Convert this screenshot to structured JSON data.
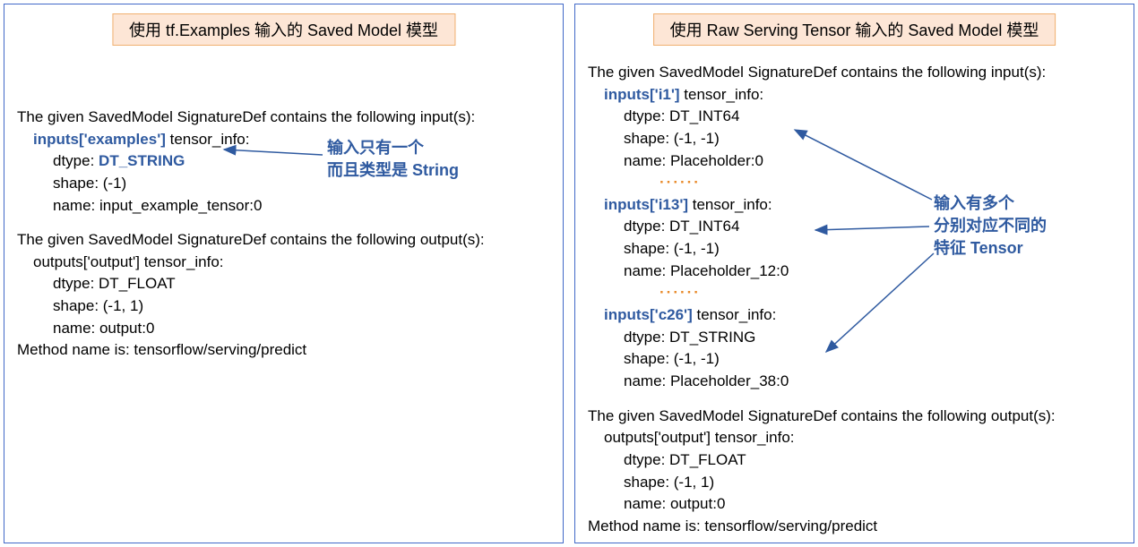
{
  "left": {
    "title": "使用 tf.Examples 输入的 Saved Model 模型",
    "head_inputs": "The given SavedModel SignatureDef contains the following input(s):",
    "input_key": "inputs['examples']",
    "tensor_info": " tensor_info:",
    "dtype_label": "dtype: ",
    "dtype_val": "DT_STRING",
    "shape": "shape: (-1)",
    "name": "name: input_example_tensor:0",
    "head_outputs": "The given SavedModel SignatureDef contains the following output(s):",
    "output_line": "outputs['output'] tensor_info:",
    "out_dtype": "dtype: DT_FLOAT",
    "out_shape": "shape: (-1, 1)",
    "out_name": "name: output:0",
    "method": "Method name is: tensorflow/serving/predict",
    "annotation_l1": "输入只有一个",
    "annotation_l2": "而且类型是 String"
  },
  "right": {
    "title": "使用 Raw Serving Tensor  输入的 Saved Model 模型",
    "head_inputs": "The given SavedModel SignatureDef contains the following input(s):",
    "i1_key": "inputs['i1']",
    "i1_dtype": "dtype: DT_INT64",
    "i1_shape": "shape: (-1, -1)",
    "i1_name": "name: Placeholder:0",
    "dots": "······",
    "i13_key": "inputs['i13']",
    "i13_dtype": "dtype: DT_INT64",
    "i13_shape": "shape: (-1, -1)",
    "i13_name": "name: Placeholder_12:0",
    "c26_key": "inputs['c26']",
    "c26_dtype": "dtype: DT_STRING",
    "c26_shape": "shape: (-1, -1)",
    "c26_name": "name: Placeholder_38:0",
    "tensor_info": " tensor_info:",
    "head_outputs": "The given SavedModel SignatureDef contains the following output(s):",
    "output_line": "outputs['output'] tensor_info:",
    "out_dtype": "dtype: DT_FLOAT",
    "out_shape": "shape: (-1, 1)",
    "out_name": "name: output:0",
    "method": "Method name is: tensorflow/serving/predict",
    "annotation_l1": "输入有多个",
    "annotation_l2": "分别对应不同的",
    "annotation_l3": "特征 Tensor"
  }
}
